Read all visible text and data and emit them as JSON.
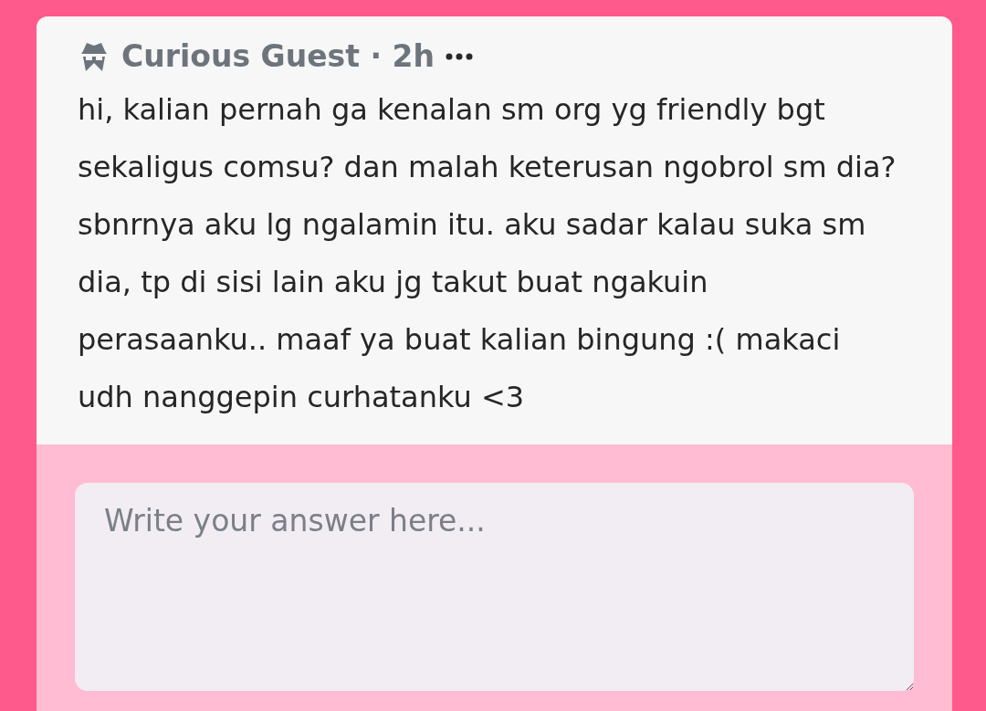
{
  "post": {
    "author": "Curious Guest · 2h",
    "body": "hi, kalian pernah ga kenalan sm org yg friendly bgt sekaligus comsu? dan malah keterusan ngobrol sm dia? sbnrnya aku lg ngalamin itu. aku sadar kalau suka sm dia, tp di sisi lain aku jg takut buat ngakuin perasaanku.. maaf ya buat kalian bingung :( makaci udh nanggepin curhatanku <3"
  },
  "answer": {
    "placeholder": "Write your answer here..."
  }
}
